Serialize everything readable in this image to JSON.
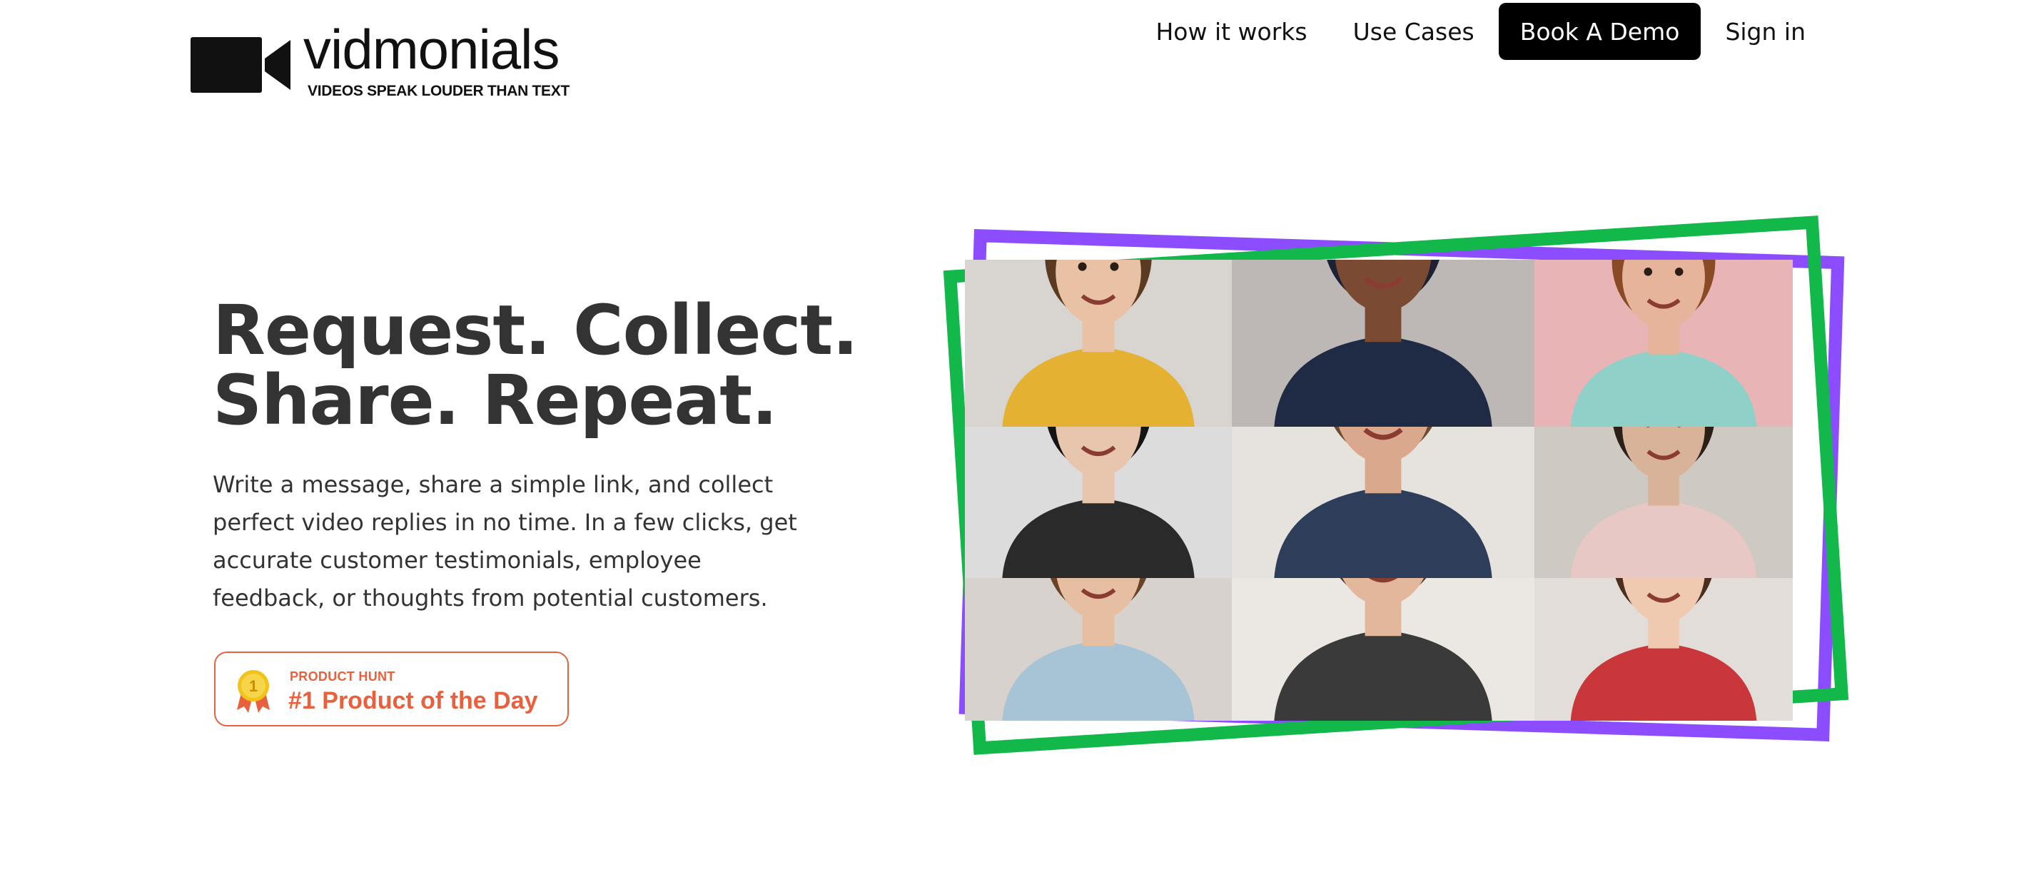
{
  "brand": {
    "name": "vidmonials",
    "tagline": "VIDEOS SPEAK LOUDER THAN TEXT",
    "icon": "video-camera-icon"
  },
  "nav": {
    "items": [
      {
        "label": "How it works"
      },
      {
        "label": "Use Cases"
      },
      {
        "label": "Book A Demo",
        "style": "button"
      },
      {
        "label": "Sign in"
      }
    ]
  },
  "hero": {
    "title_line1": "Request. Collect.",
    "title_line2": "Share. Repeat.",
    "description": "Write a message, share a simple link, and collect perfect video replies in no time. In a few clicks, get accurate customer testimonials, employee feedback, or thoughts from potential customers."
  },
  "badge": {
    "kicker": "PRODUCT HUNT",
    "title": "#1 Product of the Day",
    "medal_number": "1",
    "color": "#e8603c"
  },
  "collage": {
    "frame_colors": {
      "purple": "#8b4dff",
      "green": "#12b84a"
    },
    "tiles": [
      {
        "bg": "#d8d4cf",
        "skin": "#e9c2a6",
        "hair": "#5a3b22",
        "shirt": "#e4b132"
      },
      {
        "bg": "#bdb8b5",
        "skin": "#7a4a33",
        "hair": "#1c2233",
        "shirt": "#1f2a44"
      },
      {
        "bg": "#e8b4b6",
        "skin": "#e5b49a",
        "hair": "#8a4a25",
        "shirt": "#8fd1c8"
      },
      {
        "bg": "#dcdcdc",
        "skin": "#e8c6ad",
        "hair": "#141414",
        "shirt": "#2a2a2a"
      },
      {
        "bg": "#e6e3de",
        "skin": "#d9a88d",
        "hair": "#6b4a33",
        "shirt": "#2d3d5a"
      },
      {
        "bg": "#cfc9c3",
        "skin": "#d9b29a",
        "hair": "#2b1f18",
        "shirt": "#e8c8c4"
      },
      {
        "bg": "#d7d2cd",
        "skin": "#e6bea2",
        "hair": "#6a4327",
        "shirt": "#a7c4d6"
      },
      {
        "bg": "#ebe7e3",
        "skin": "#e2b79c",
        "hair": "#4a3a2e",
        "shirt": "#3a3a3a"
      },
      {
        "bg": "#e2ddd8",
        "skin": "#efc9b0",
        "hair": "#4a2f1f",
        "shirt": "#c9373b"
      }
    ]
  }
}
